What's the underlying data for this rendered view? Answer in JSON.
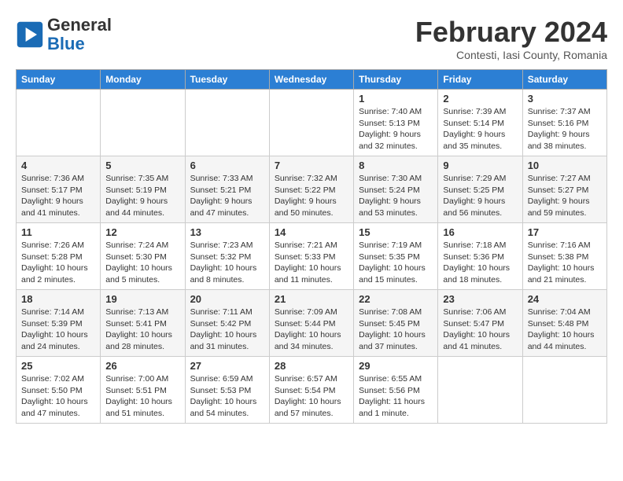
{
  "logo": {
    "text_general": "General",
    "text_blue": "Blue"
  },
  "title": "February 2024",
  "subtitle": "Contesti, Iasi County, Romania",
  "days_of_week": [
    "Sunday",
    "Monday",
    "Tuesday",
    "Wednesday",
    "Thursday",
    "Friday",
    "Saturday"
  ],
  "weeks": [
    [
      {
        "day": "",
        "info": ""
      },
      {
        "day": "",
        "info": ""
      },
      {
        "day": "",
        "info": ""
      },
      {
        "day": "",
        "info": ""
      },
      {
        "day": "1",
        "info": "Sunrise: 7:40 AM\nSunset: 5:13 PM\nDaylight: 9 hours\nand 32 minutes."
      },
      {
        "day": "2",
        "info": "Sunrise: 7:39 AM\nSunset: 5:14 PM\nDaylight: 9 hours\nand 35 minutes."
      },
      {
        "day": "3",
        "info": "Sunrise: 7:37 AM\nSunset: 5:16 PM\nDaylight: 9 hours\nand 38 minutes."
      }
    ],
    [
      {
        "day": "4",
        "info": "Sunrise: 7:36 AM\nSunset: 5:17 PM\nDaylight: 9 hours\nand 41 minutes."
      },
      {
        "day": "5",
        "info": "Sunrise: 7:35 AM\nSunset: 5:19 PM\nDaylight: 9 hours\nand 44 minutes."
      },
      {
        "day": "6",
        "info": "Sunrise: 7:33 AM\nSunset: 5:21 PM\nDaylight: 9 hours\nand 47 minutes."
      },
      {
        "day": "7",
        "info": "Sunrise: 7:32 AM\nSunset: 5:22 PM\nDaylight: 9 hours\nand 50 minutes."
      },
      {
        "day": "8",
        "info": "Sunrise: 7:30 AM\nSunset: 5:24 PM\nDaylight: 9 hours\nand 53 minutes."
      },
      {
        "day": "9",
        "info": "Sunrise: 7:29 AM\nSunset: 5:25 PM\nDaylight: 9 hours\nand 56 minutes."
      },
      {
        "day": "10",
        "info": "Sunrise: 7:27 AM\nSunset: 5:27 PM\nDaylight: 9 hours\nand 59 minutes."
      }
    ],
    [
      {
        "day": "11",
        "info": "Sunrise: 7:26 AM\nSunset: 5:28 PM\nDaylight: 10 hours\nand 2 minutes."
      },
      {
        "day": "12",
        "info": "Sunrise: 7:24 AM\nSunset: 5:30 PM\nDaylight: 10 hours\nand 5 minutes."
      },
      {
        "day": "13",
        "info": "Sunrise: 7:23 AM\nSunset: 5:32 PM\nDaylight: 10 hours\nand 8 minutes."
      },
      {
        "day": "14",
        "info": "Sunrise: 7:21 AM\nSunset: 5:33 PM\nDaylight: 10 hours\nand 11 minutes."
      },
      {
        "day": "15",
        "info": "Sunrise: 7:19 AM\nSunset: 5:35 PM\nDaylight: 10 hours\nand 15 minutes."
      },
      {
        "day": "16",
        "info": "Sunrise: 7:18 AM\nSunset: 5:36 PM\nDaylight: 10 hours\nand 18 minutes."
      },
      {
        "day": "17",
        "info": "Sunrise: 7:16 AM\nSunset: 5:38 PM\nDaylight: 10 hours\nand 21 minutes."
      }
    ],
    [
      {
        "day": "18",
        "info": "Sunrise: 7:14 AM\nSunset: 5:39 PM\nDaylight: 10 hours\nand 24 minutes."
      },
      {
        "day": "19",
        "info": "Sunrise: 7:13 AM\nSunset: 5:41 PM\nDaylight: 10 hours\nand 28 minutes."
      },
      {
        "day": "20",
        "info": "Sunrise: 7:11 AM\nSunset: 5:42 PM\nDaylight: 10 hours\nand 31 minutes."
      },
      {
        "day": "21",
        "info": "Sunrise: 7:09 AM\nSunset: 5:44 PM\nDaylight: 10 hours\nand 34 minutes."
      },
      {
        "day": "22",
        "info": "Sunrise: 7:08 AM\nSunset: 5:45 PM\nDaylight: 10 hours\nand 37 minutes."
      },
      {
        "day": "23",
        "info": "Sunrise: 7:06 AM\nSunset: 5:47 PM\nDaylight: 10 hours\nand 41 minutes."
      },
      {
        "day": "24",
        "info": "Sunrise: 7:04 AM\nSunset: 5:48 PM\nDaylight: 10 hours\nand 44 minutes."
      }
    ],
    [
      {
        "day": "25",
        "info": "Sunrise: 7:02 AM\nSunset: 5:50 PM\nDaylight: 10 hours\nand 47 minutes."
      },
      {
        "day": "26",
        "info": "Sunrise: 7:00 AM\nSunset: 5:51 PM\nDaylight: 10 hours\nand 51 minutes."
      },
      {
        "day": "27",
        "info": "Sunrise: 6:59 AM\nSunset: 5:53 PM\nDaylight: 10 hours\nand 54 minutes."
      },
      {
        "day": "28",
        "info": "Sunrise: 6:57 AM\nSunset: 5:54 PM\nDaylight: 10 hours\nand 57 minutes."
      },
      {
        "day": "29",
        "info": "Sunrise: 6:55 AM\nSunset: 5:56 PM\nDaylight: 11 hours\nand 1 minute."
      },
      {
        "day": "",
        "info": ""
      },
      {
        "day": "",
        "info": ""
      }
    ]
  ]
}
